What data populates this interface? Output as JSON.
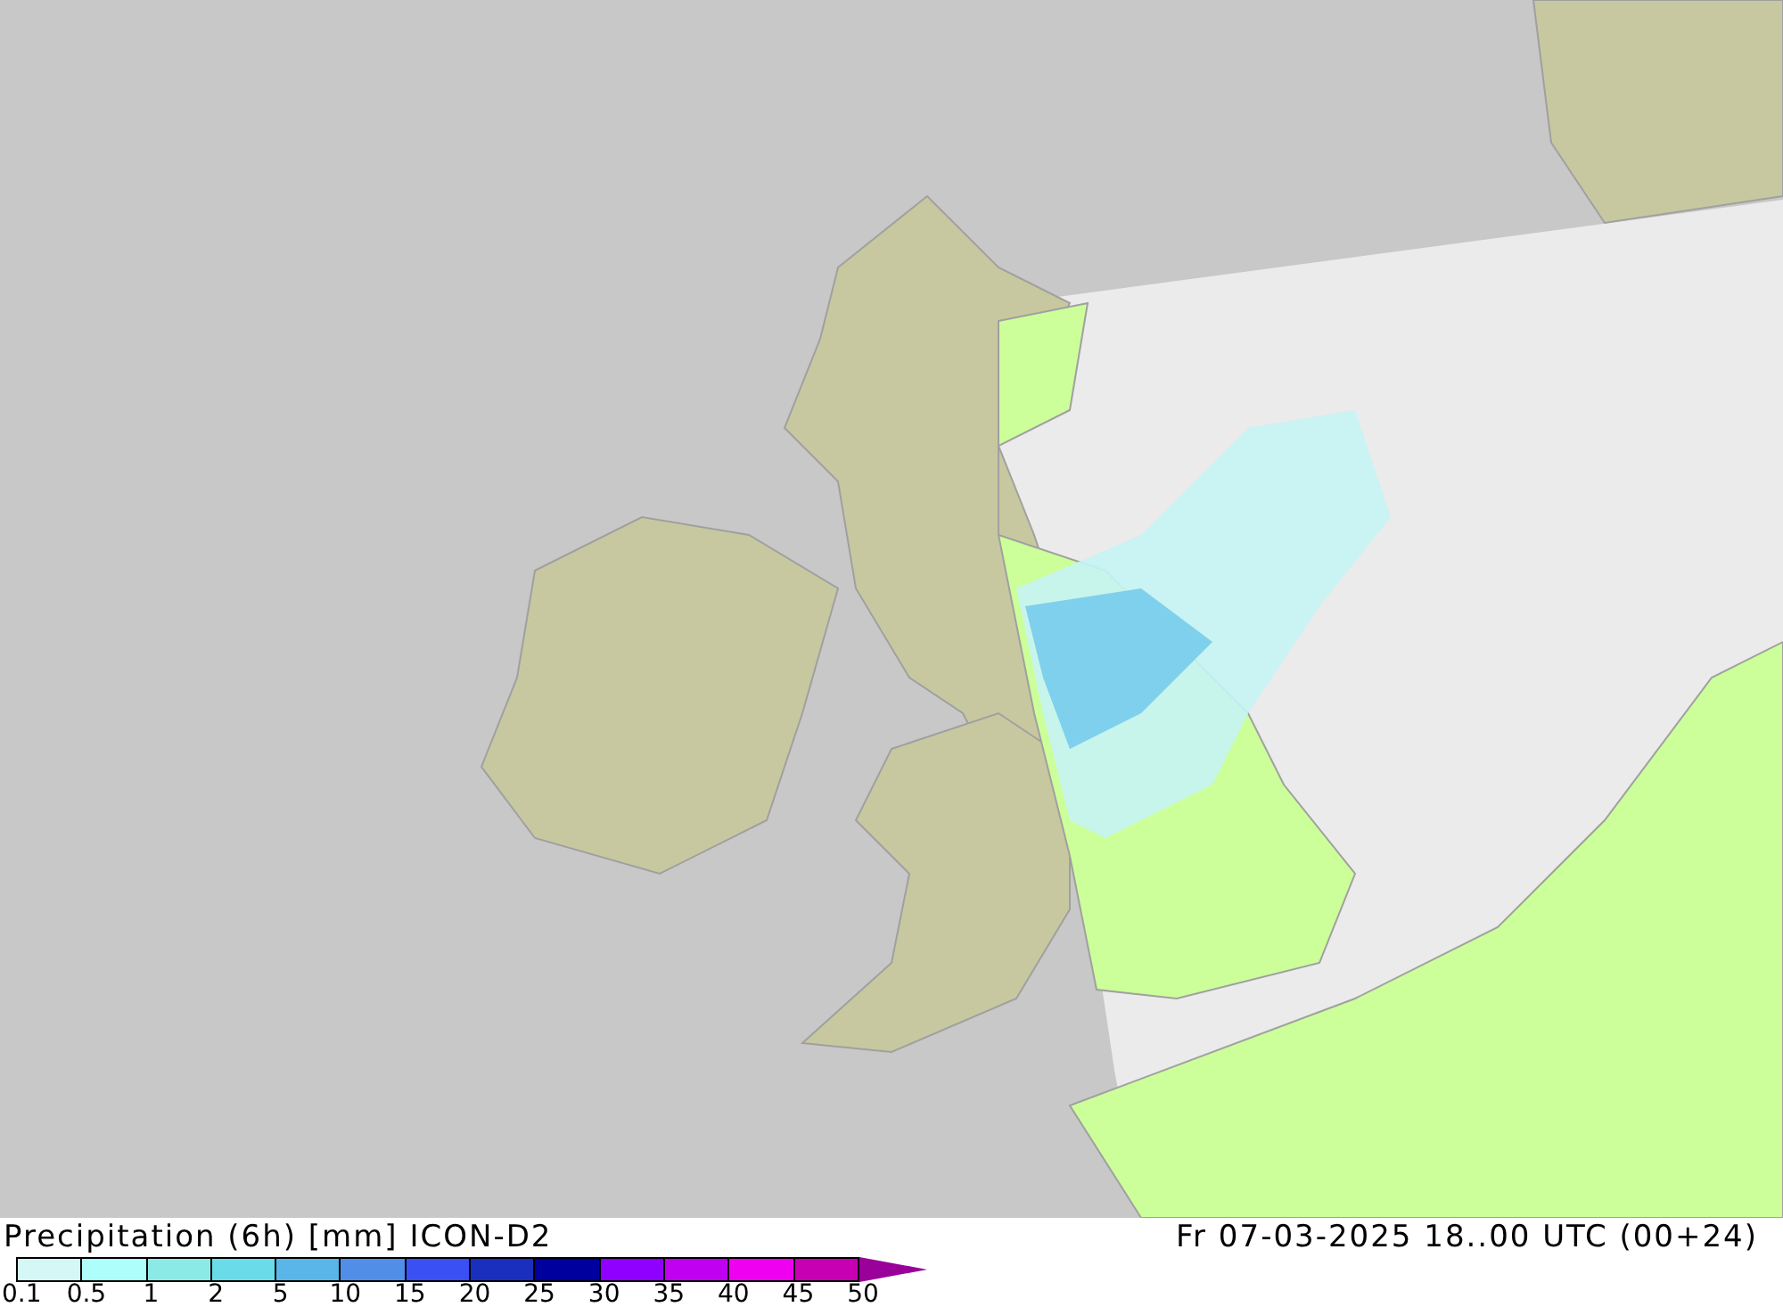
{
  "legend": {
    "title": "Precipitation (6h) [mm] ICON-D2",
    "valid_time": "Fr 07-03-2025 18..00 UTC (00+24)",
    "colorbar": {
      "swatches": [
        {
          "color": "#d5f7f5"
        },
        {
          "color": "#aefffc"
        },
        {
          "color": "#8ceae6"
        },
        {
          "color": "#6adbe9"
        },
        {
          "color": "#5ab6e8"
        },
        {
          "color": "#508ee8"
        },
        {
          "color": "#3a50f5"
        },
        {
          "color": "#1b2fbf"
        },
        {
          "color": "#00009e"
        },
        {
          "color": "#9000ff"
        },
        {
          "color": "#c000f0"
        },
        {
          "color": "#f000f0"
        },
        {
          "color": "#c800b4"
        },
        {
          "kind": "arrow",
          "color": "#9a009a"
        }
      ],
      "ticks": [
        "0.1",
        "0.5",
        "1",
        "2",
        "5",
        "10",
        "15",
        "20",
        "25",
        "30",
        "35",
        "40",
        "45",
        "50"
      ]
    }
  }
}
